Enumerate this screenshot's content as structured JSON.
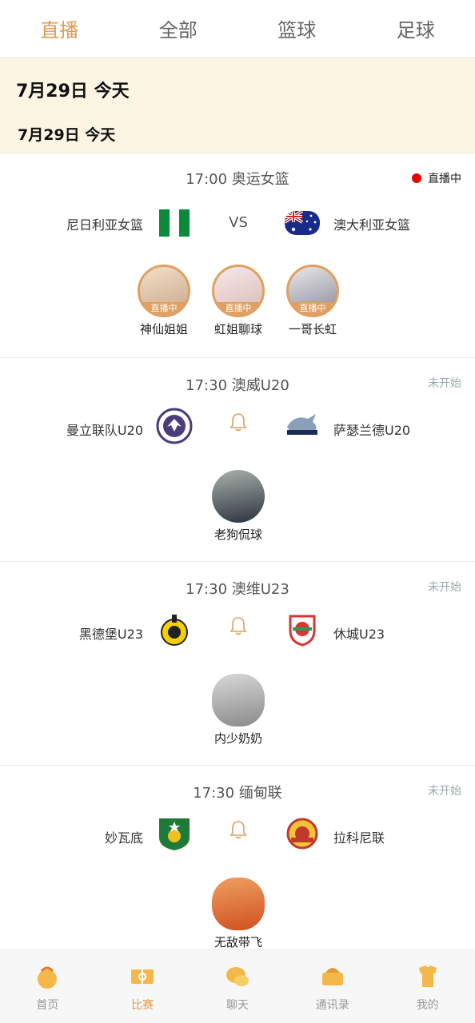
{
  "tabs": [
    {
      "label": "直播"
    },
    {
      "label": "全部"
    },
    {
      "label": "篮球"
    },
    {
      "label": "足球"
    }
  ],
  "date_header_big": "7月29日  今天",
  "date_header_small": "7月29日  今天",
  "matches": [
    {
      "title": "17:00  奥运女篮",
      "status": "直播中",
      "home": "尼日利亚女篮",
      "away": "澳大利亚女篮",
      "center": "VS",
      "anchors": [
        {
          "name": "神仙姐姐",
          "tag": "直播中"
        },
        {
          "name": "虹姐聊球",
          "tag": "直播中"
        },
        {
          "name": "一哥长虹",
          "tag": "直播中"
        }
      ]
    },
    {
      "title": "17:30  澳威U20",
      "status": "未开始",
      "home": "曼立联队U20",
      "away": "萨瑟兰德U20",
      "anchors": [
        {
          "name": "老狗侃球"
        }
      ]
    },
    {
      "title": "17:30  澳维U23",
      "status": "未开始",
      "home": "黑德堡U23",
      "away": "休城U23",
      "anchors": [
        {
          "name": "内少奶奶"
        }
      ]
    },
    {
      "title": "17:30  缅甸联",
      "status": "未开始",
      "home": "妙瓦底",
      "away": "拉科尼联",
      "anchors": [
        {
          "name": "无敌带飞"
        }
      ]
    }
  ],
  "nav": [
    {
      "label": "首页",
      "icon": "home-icon"
    },
    {
      "label": "比赛",
      "icon": "match-icon"
    },
    {
      "label": "聊天",
      "icon": "chat-icon"
    },
    {
      "label": "通讯录",
      "icon": "contacts-icon"
    },
    {
      "label": "我的",
      "icon": "profile-icon"
    }
  ],
  "colors": {
    "accent": "#e0994f",
    "live": "#ee0000",
    "date_bg": "#fdf5e4"
  }
}
